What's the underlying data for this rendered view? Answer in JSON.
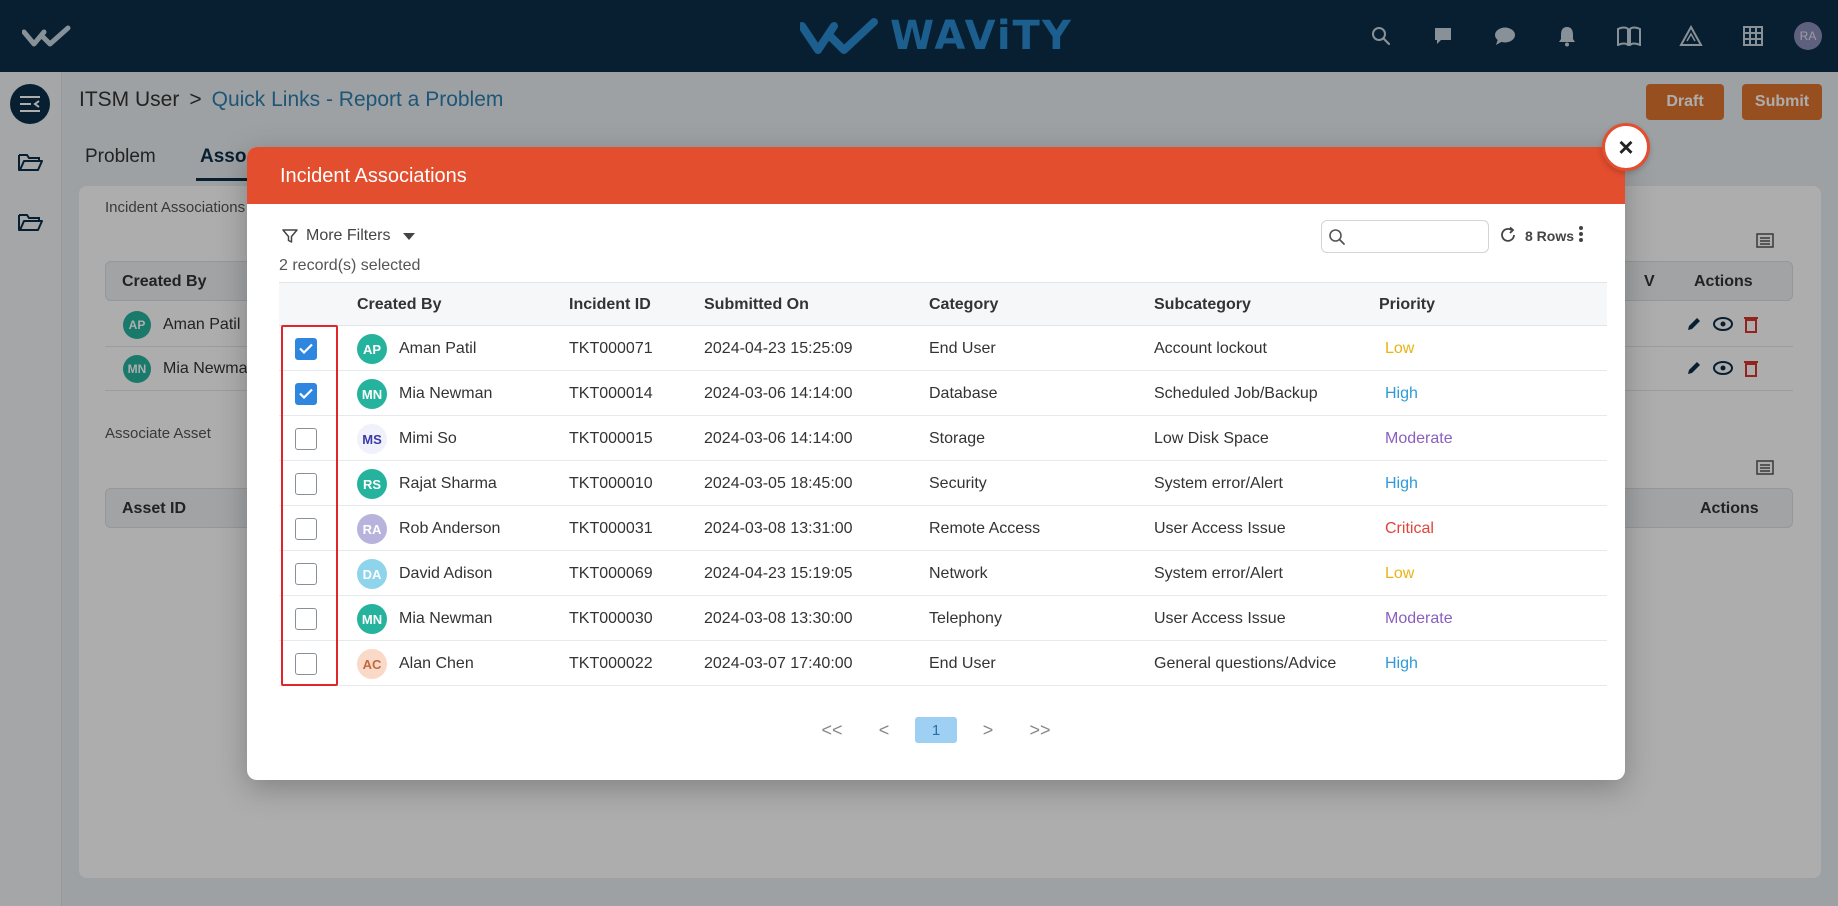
{
  "brand": {
    "name": "WAViTY",
    "user_initials": "RA"
  },
  "breadcrumb": {
    "root": "ITSM User",
    "separator": ">",
    "current": "Quick Links - Report a Problem"
  },
  "actions": {
    "draft": "Draft",
    "submit": "Submit"
  },
  "tabs": [
    {
      "label": "Problem"
    },
    {
      "label": "Associ"
    }
  ],
  "background": {
    "incident_associations_label": "Incident Associations",
    "associate_asset_label": "Associate Asset",
    "columns": {
      "created_by": "Created By",
      "v": "V",
      "actions": "Actions"
    },
    "asset_columns": {
      "asset_id": "Asset ID",
      "actions": "Actions"
    },
    "rows": [
      {
        "initials": "AP",
        "name": "Aman Patil"
      },
      {
        "initials": "MN",
        "name": "Mia Newma"
      }
    ]
  },
  "modal": {
    "title": "Incident Associations",
    "close": "×",
    "more_filters": "More Filters",
    "selected_count": "2 record(s) selected",
    "search_placeholder": "",
    "rows_label": "8 Rows",
    "columns": {
      "created_by": "Created By",
      "incident_id": "Incident ID",
      "submitted_on": "Submitted On",
      "category": "Category",
      "subcategory": "Subcategory",
      "priority": "Priority"
    },
    "rows": [
      {
        "checked": true,
        "initials": "AP",
        "avatar_bg": "#25b39e",
        "avatar_fg": "#ffffff",
        "name": "Aman Patil",
        "id": "TKT000071",
        "submitted": "2024-04-23 15:25:09",
        "category": "End User",
        "subcategory": "Account lockout",
        "priority": "Low",
        "priority_color": "#e8b414"
      },
      {
        "checked": true,
        "initials": "MN",
        "avatar_bg": "#25b39e",
        "avatar_fg": "#ffffff",
        "name": "Mia Newman",
        "id": "TKT000014",
        "submitted": "2024-03-06 14:14:00",
        "category": "Database",
        "subcategory": "Scheduled Job/Backup",
        "priority": "High",
        "priority_color": "#2f9ad8"
      },
      {
        "checked": false,
        "initials": "MS",
        "avatar_bg": "#f1f1fb",
        "avatar_fg": "#3a3aa8",
        "name": "Mimi So",
        "id": "TKT000015",
        "submitted": "2024-03-06 14:14:00",
        "category": "Storage",
        "subcategory": "Low Disk Space",
        "priority": "Moderate",
        "priority_color": "#8a5fc0"
      },
      {
        "checked": false,
        "initials": "RS",
        "avatar_bg": "#25b39e",
        "avatar_fg": "#ffffff",
        "name": "Rajat Sharma",
        "id": "TKT000010",
        "submitted": "2024-03-05 18:45:00",
        "category": "Security",
        "subcategory": "System error/Alert",
        "priority": "High",
        "priority_color": "#2f9ad8"
      },
      {
        "checked": false,
        "initials": "RA",
        "avatar_bg": "#b8b3dc",
        "avatar_fg": "#ffffff",
        "name": "Rob Anderson",
        "id": "TKT000031",
        "submitted": "2024-03-08 13:31:00",
        "category": "Remote Access",
        "subcategory": "User Access Issue",
        "priority": "Critical",
        "priority_color": "#e0443a"
      },
      {
        "checked": false,
        "initials": "DA",
        "avatar_bg": "#8ed4ea",
        "avatar_fg": "#ffffff",
        "name": "David Adison",
        "id": "TKT000069",
        "submitted": "2024-04-23 15:19:05",
        "category": "Network",
        "subcategory": "System error/Alert",
        "priority": "Low",
        "priority_color": "#e8b414"
      },
      {
        "checked": false,
        "initials": "MN",
        "avatar_bg": "#25b39e",
        "avatar_fg": "#ffffff",
        "name": "Mia Newman",
        "id": "TKT000030",
        "submitted": "2024-03-08 13:30:00",
        "category": "Telephony",
        "subcategory": "User Access Issue",
        "priority": "Moderate",
        "priority_color": "#8a5fc0"
      },
      {
        "checked": false,
        "initials": "AC",
        "avatar_bg": "#fbd9c8",
        "avatar_fg": "#c06a3c",
        "name": "Alan Chen",
        "id": "TKT000022",
        "submitted": "2024-03-07 17:40:00",
        "category": "End User",
        "subcategory": "General questions/Advice",
        "priority": "High",
        "priority_color": "#2f9ad8"
      }
    ],
    "pager": {
      "first": "<<",
      "prev": "<",
      "page": "1",
      "next": ">",
      "last": ">>"
    }
  }
}
